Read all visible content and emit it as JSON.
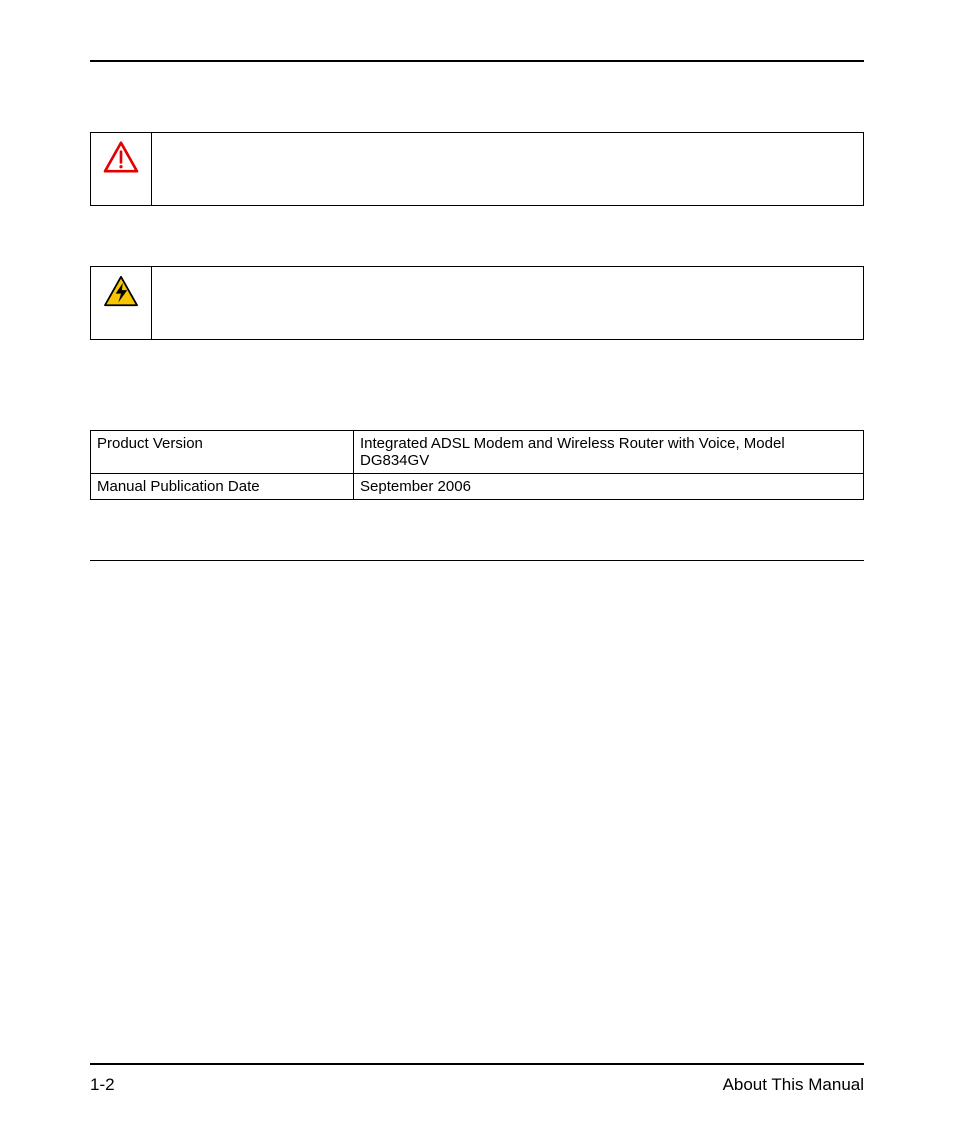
{
  "callouts": {
    "warning": {
      "icon": "warning-triangle"
    },
    "danger": {
      "icon": "electric-triangle"
    }
  },
  "table": {
    "rows": [
      {
        "label": "Product Version",
        "value": "Integrated ADSL Modem and Wireless Router with Voice, Model DG834GV"
      },
      {
        "label": "Manual Publication Date",
        "value": "September 2006"
      }
    ]
  },
  "footer": {
    "page_number": "1-2",
    "section": "About This Manual"
  }
}
